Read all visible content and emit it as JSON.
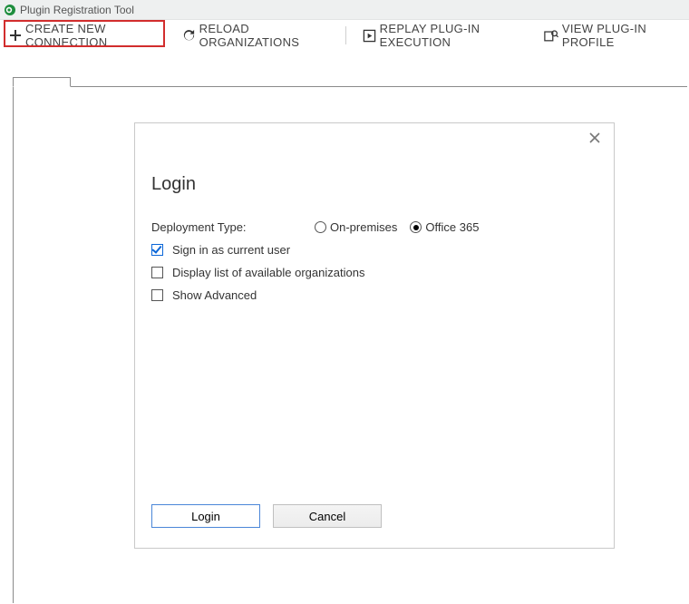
{
  "app_title": "Plugin Registration Tool",
  "toolbar": {
    "create_connection": "CREATE NEW CONNECTION",
    "reload_orgs": "RELOAD ORGANIZATIONS",
    "replay_plugin": "REPLAY PLUG-IN EXECUTION",
    "view_profile": "VIEW PLUG-IN PROFILE"
  },
  "dialog": {
    "title": "Login",
    "deployment_label": "Deployment Type:",
    "radio_onprem": "On-premises",
    "radio_o365": "Office 365",
    "selected_deployment": "o365",
    "check_signin_label": "Sign in as current user",
    "check_signin_checked": true,
    "check_displaylist_label": "Display list of available organizations",
    "check_displaylist_checked": false,
    "check_advanced_label": "Show Advanced",
    "check_advanced_checked": false,
    "btn_login": "Login",
    "btn_cancel": "Cancel"
  }
}
